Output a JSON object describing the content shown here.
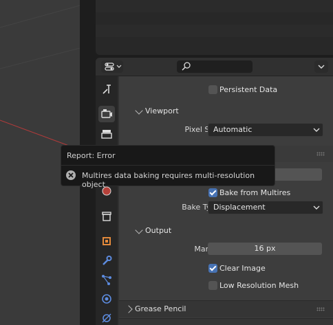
{
  "tooltip": {
    "title": "Report: Error",
    "message": "Multires data baking requires multi-resolution object"
  },
  "props": {
    "persistent_data_label": "Persistent Data",
    "viewport_panel": "Viewport",
    "pixel_size_label": "Pixel Size",
    "pixel_size_value": "Automatic",
    "bake_from_multires_label": "Bake from Multires",
    "bake_type_label": "Bake Type",
    "bake_type_value": "Displacement",
    "output_panel": "Output",
    "margin_label": "Margin",
    "margin_value": "16 px",
    "clear_image_label": "Clear Image",
    "low_res_mesh_label": "Low Resolution Mesh",
    "grease_pencil_panel": "Grease Pencil"
  },
  "checkboxes": {
    "persistent_data": false,
    "bake_from_multires": true,
    "clear_image": true,
    "low_res_mesh": false
  },
  "colors": {
    "accent": "#4772b3",
    "error_icon": "#b0b0b0"
  },
  "tabs": [
    "tool-tab",
    "render-tab",
    "output-tab",
    "view-layer-tab",
    "scene-tab",
    "world-tab",
    "collection-tab",
    "object-tab",
    "modifier-tab",
    "particles-tab",
    "physics-tab",
    "constraints-tab"
  ]
}
